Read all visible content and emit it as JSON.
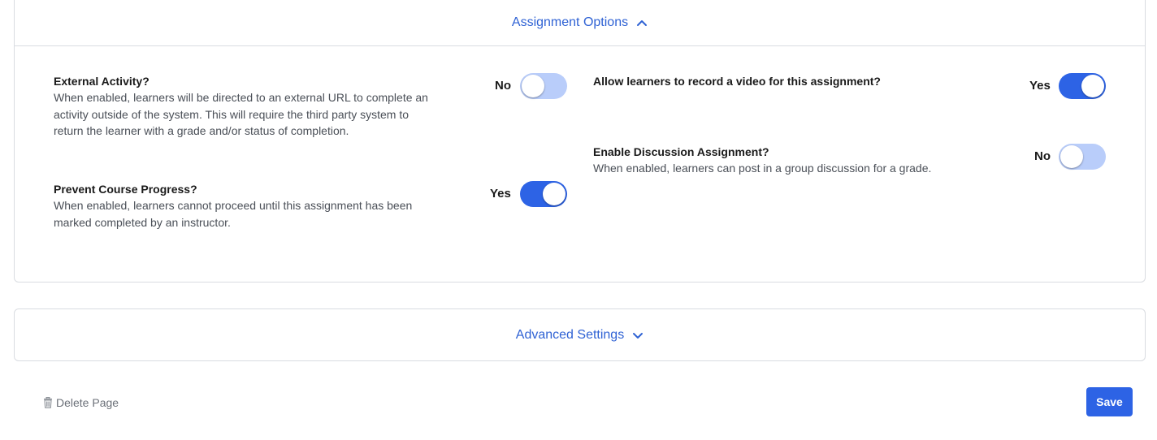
{
  "assignment_options": {
    "header_label": "Assignment Options",
    "header_icon": "chevron-up-icon",
    "options": {
      "external_activity": {
        "title": "External Activity?",
        "description": "When enabled, learners will be directed to an external URL to complete an activity outside of the system. This will require the third party system to return the learner with a grade and/or status of completion.",
        "state_label": "No",
        "enabled": false
      },
      "prevent_progress": {
        "title": "Prevent Course Progress?",
        "description": "When enabled, learners cannot proceed until this assignment has been marked completed by an instructor.",
        "state_label": "Yes",
        "enabled": true
      },
      "record_video": {
        "title": "Allow learners to record a video for this assignment?",
        "state_label": "Yes",
        "enabled": true
      },
      "discussion": {
        "title": "Enable Discussion Assignment?",
        "description": "When enabled, learners can post in a group discussion for a grade.",
        "state_label": "No",
        "enabled": false
      }
    }
  },
  "advanced_settings": {
    "header_label": "Advanced Settings",
    "header_icon": "chevron-down-icon"
  },
  "footer": {
    "delete_label": "Delete Page",
    "delete_icon": "trash-icon",
    "save_label": "Save"
  },
  "colors": {
    "accent": "#2d63e5",
    "link": "#2f62d4",
    "toggle_off": "#b9cdfa"
  }
}
